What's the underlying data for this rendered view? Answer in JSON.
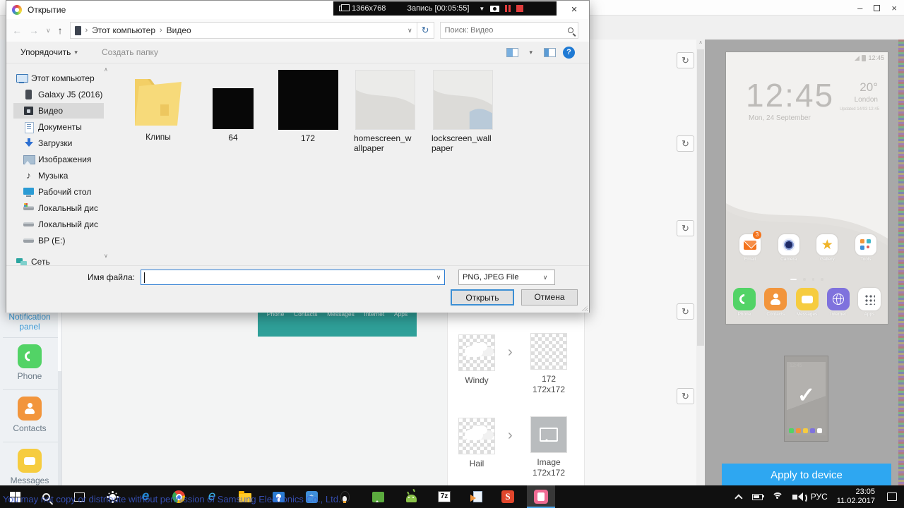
{
  "glyphs": {
    "close": "×",
    "minimize": "–",
    "back": "←",
    "forward": "→",
    "up": "↑",
    "dropdown": "∨",
    "caret_up": "∧",
    "chevron": "›",
    "refresh": "↻",
    "menu_caret": "▾",
    "triangle_down": "▼",
    "check": "✓",
    "star": "★",
    "note": "♪",
    "help": "?",
    "seven_zip": "7z",
    "s_letter": "S",
    "e_letter": "e",
    "store_glyph": "÷"
  },
  "recording_bar": {
    "resolution": "1366x768",
    "status": "Запись [00:05:55]"
  },
  "editor_window": {
    "sidebar": {
      "items": [
        {
          "label": "Notification panel",
          "active": true
        },
        {
          "label": "Phone"
        },
        {
          "label": "Contacts"
        },
        {
          "label": "Messages"
        }
      ]
    },
    "canvas_tabs": [
      "Phone",
      "Contacts",
      "Messages",
      "Internet",
      "Apps"
    ],
    "mappings": [
      {
        "source": "Windy",
        "target_name": "172",
        "target_size": "172x172"
      },
      {
        "source": "Hail",
        "target_name": "Image",
        "target_size": "172x172"
      }
    ],
    "phone_preview": {
      "status_time": "12:45",
      "clock": "12:45",
      "date": "Mon, 24 September",
      "temperature": "20°",
      "city": "London",
      "updated": "Updated 14/03 12:45",
      "apps_row": [
        {
          "label": "Email",
          "badge": "3"
        },
        {
          "label": "Camera"
        },
        {
          "label": "Gallery"
        },
        {
          "label": "Tools"
        }
      ],
      "dock": [
        "Phone",
        "Contacts",
        "Messages",
        "Internet",
        "Apps"
      ],
      "apply_button": "Apply to device"
    }
  },
  "dialog": {
    "title": "Открытие",
    "breadcrumb": {
      "items": [
        "Этот компьютер",
        "Видео"
      ]
    },
    "search_placeholder": "Поиск: Видео",
    "toolbar": {
      "organize": "Упорядочить",
      "new_folder": "Создать папку"
    },
    "sidebar": [
      {
        "label": "Этот компьютер"
      },
      {
        "label": "Galaxy J5 (2016)"
      },
      {
        "label": "Видео",
        "selected": true
      },
      {
        "label": "Документы"
      },
      {
        "label": "Загрузки"
      },
      {
        "label": "Изображения"
      },
      {
        "label": "Музыка"
      },
      {
        "label": "Рабочий стол"
      },
      {
        "label": "Локальный дис"
      },
      {
        "label": "Локальный дис"
      },
      {
        "label": "BP (E:)"
      },
      {
        "label": "Сеть"
      }
    ],
    "files": [
      {
        "label": "Клипы",
        "type": "folder"
      },
      {
        "label": "64",
        "type": "black-small"
      },
      {
        "label": "172",
        "type": "black-large"
      },
      {
        "label": "homescreen_wallpaper",
        "type": "wallpaper"
      },
      {
        "label": "lockscreen_wallpaper",
        "type": "wallpaper-lock"
      }
    ],
    "footer": {
      "filename_label": "Имя файла:",
      "filename_value": "",
      "filetype_value": "PNG, JPEG File",
      "open_button": "Открыть",
      "cancel_button": "Отмена"
    }
  },
  "taskbar": {
    "icons": [
      "start",
      "search",
      "task-view",
      "brightness",
      "edge",
      "chrome",
      "internet-explorer",
      "file-explorer",
      "people",
      "blue-app",
      "linux",
      "image-viewer",
      "android",
      "7zip",
      "converter",
      "s-app",
      "theme-designer"
    ],
    "tray": {
      "language": "РУС",
      "time": "23:05",
      "date": "11.02.2017"
    }
  },
  "watermark": "You may not copy or distribute without permission of Samsung Electronics Co., Ltd."
}
